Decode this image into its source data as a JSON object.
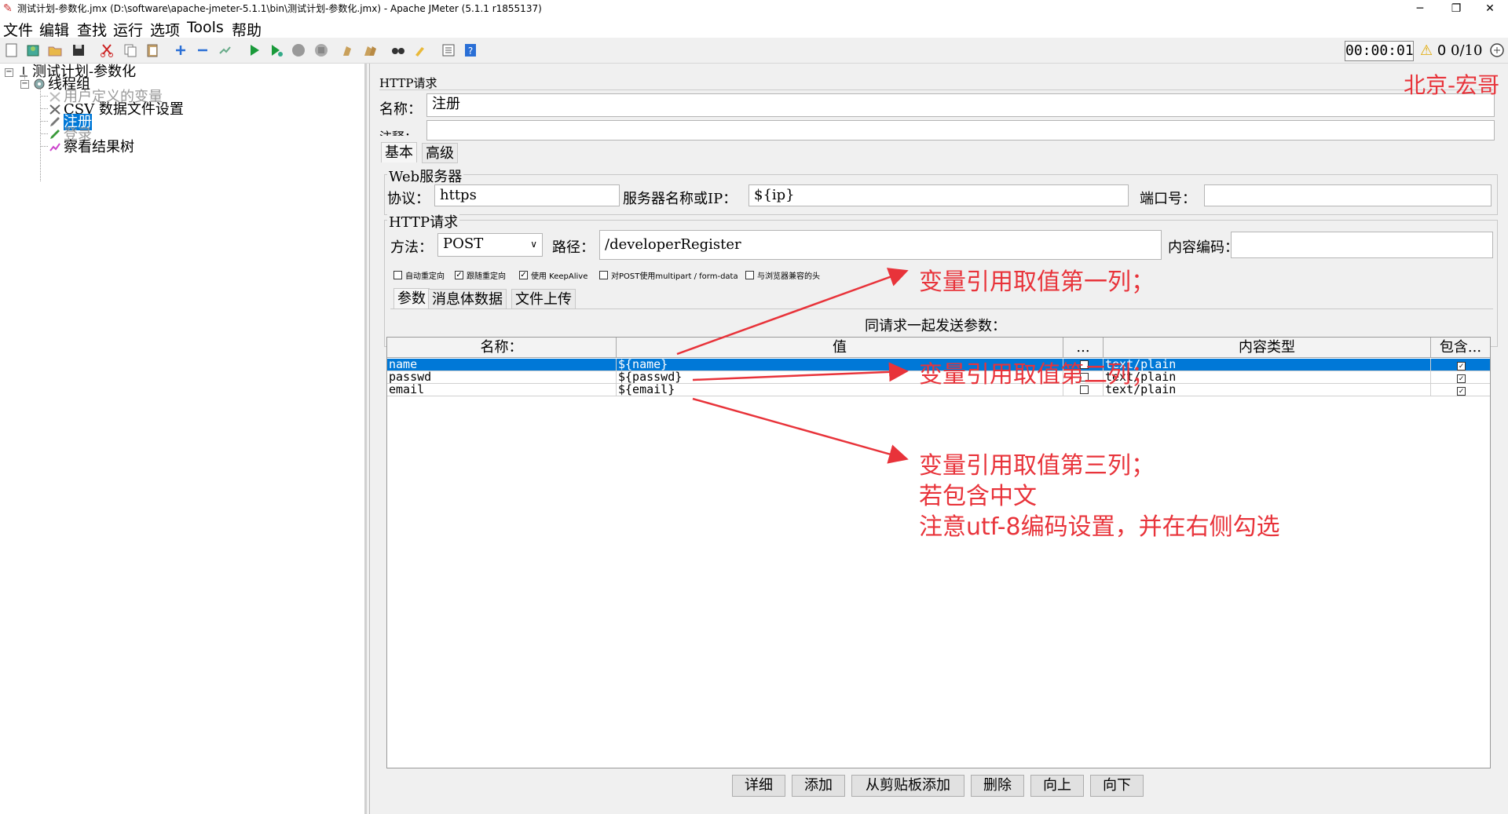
{
  "window": {
    "title": "测试计划-参数化.jmx (D:\\software\\apache-jmeter-5.1.1\\bin\\测试计划-参数化.jmx) - Apache JMeter (5.1.1 r1855137)",
    "minimize": "─",
    "restore": "❐",
    "close": "✕"
  },
  "menu": [
    "文件",
    "编辑",
    "查找",
    "运行",
    "选项",
    "Tools",
    "帮助"
  ],
  "toolbar": {
    "timer": "00:00:01",
    "warning_count": "0",
    "threads": "0/10",
    "warning_icon": "warning-icon"
  },
  "tree": {
    "plan": "测试计划-参数化",
    "thread_group": "线程组",
    "user_vars": "用户定义的变量",
    "csv": "CSV 数据文件设置",
    "register": "注册",
    "login": "登录",
    "results_tree": "察看结果树"
  },
  "panel": {
    "header": "HTTP请求",
    "name_label": "名称：",
    "name_value": "注册",
    "comment_label": "注释：",
    "watermark": "北京-宏哥",
    "tabs": [
      "基本",
      "高级"
    ],
    "web_server": {
      "title": "Web服务器",
      "protocol_label": "协议：",
      "protocol_value": "https",
      "server_label": "服务器名称或IP：",
      "server_value": "${ip}",
      "port_label": "端口号：",
      "port_value": ""
    },
    "http_request": {
      "title": "HTTP请求",
      "method_label": "方法：",
      "method_value": "POST",
      "path_label": "路径：",
      "path_value": "/developerRegister",
      "encoding_label": "内容编码：",
      "encoding_value": ""
    },
    "options": [
      {
        "label": "自动重定向",
        "checked": false
      },
      {
        "label": "跟随重定向",
        "checked": true
      },
      {
        "label": "使用 KeepAlive",
        "checked": true
      },
      {
        "label": "对POST使用multipart / form-data",
        "checked": false
      },
      {
        "label": "与浏览器兼容的头",
        "checked": false
      }
    ],
    "sub_tabs": [
      "参数",
      "消息体数据",
      "文件上传"
    ],
    "params_caption": "同请求一起发送参数：",
    "columns": [
      "名称：",
      "值",
      "...",
      "内容类型",
      "包含..."
    ],
    "rows": [
      {
        "name": "name",
        "value": "${name}",
        "encode": false,
        "content_type": "text/plain",
        "include": true
      },
      {
        "name": "passwd",
        "value": "${passwd}",
        "encode": false,
        "content_type": "text/plain",
        "include": true
      },
      {
        "name": "email",
        "value": "${email}",
        "encode": false,
        "content_type": "text/plain",
        "include": true
      }
    ],
    "buttons": [
      "详细",
      "添加",
      "从剪贴板添加",
      "删除",
      "向上",
      "向下"
    ]
  },
  "annotations": {
    "col1": "变量引用取值第一列；",
    "col2": "变量引用取值第二列；",
    "col3_line1": "变量引用取值第三列；",
    "col3_line2": "若包含中文",
    "col3_line3": "注意utf-8编码设置，并在右侧勾选",
    "color": "#e8333a"
  }
}
